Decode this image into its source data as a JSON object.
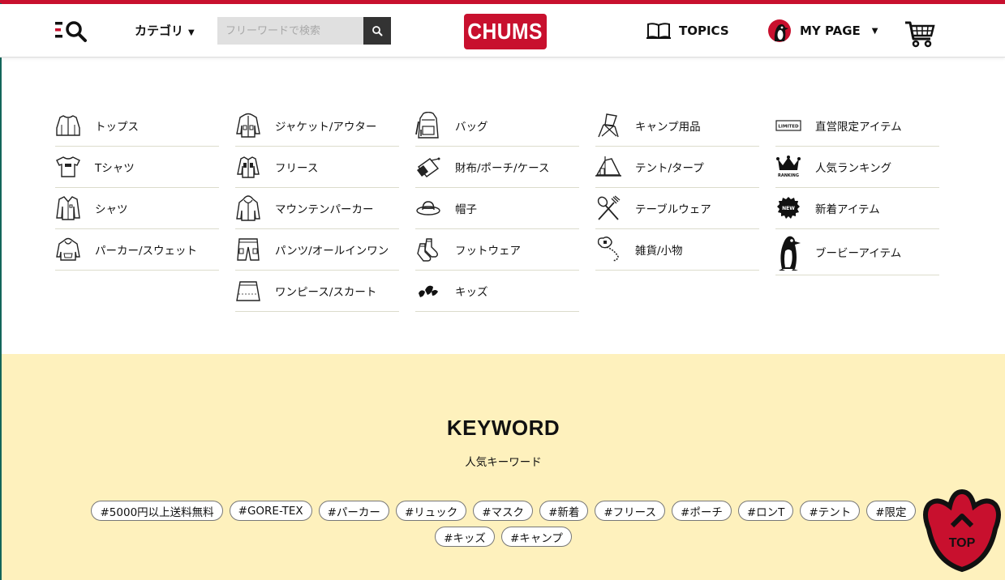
{
  "header": {
    "category_label": "カテゴリ",
    "search_placeholder": "フリーワードで検索",
    "logo_text": "CHUMS",
    "topics_label": "TOPICS",
    "mypage_label": "MY PAGE"
  },
  "categories": [
    [
      {
        "label": "トップス",
        "icon": "jacket-icon"
      },
      {
        "label": "Tシャツ",
        "icon": "tshirt-icon"
      },
      {
        "label": "シャツ",
        "icon": "shirt-icon"
      },
      {
        "label": "パーカー/スウェット",
        "icon": "hoodie-icon"
      }
    ],
    [
      {
        "label": "ジャケット/アウター",
        "icon": "outer-jacket-icon"
      },
      {
        "label": "フリース",
        "icon": "fleece-icon"
      },
      {
        "label": "マウンテンパーカー",
        "icon": "mountain-parka-icon"
      },
      {
        "label": "パンツ/オールインワン",
        "icon": "pants-icon"
      },
      {
        "label": "ワンピース/スカート",
        "icon": "skirt-icon"
      }
    ],
    [
      {
        "label": "バッグ",
        "icon": "backpack-icon"
      },
      {
        "label": "財布/ポーチ/ケース",
        "icon": "wallet-icon"
      },
      {
        "label": "帽子",
        "icon": "hat-icon"
      },
      {
        "label": "フットウェア",
        "icon": "socks-icon"
      },
      {
        "label": "キッズ",
        "icon": "kids-icon"
      }
    ],
    [
      {
        "label": "キャンプ用品",
        "icon": "camp-chair-icon"
      },
      {
        "label": "テント/タープ",
        "icon": "tent-icon"
      },
      {
        "label": "テーブルウェア",
        "icon": "cutlery-icon"
      },
      {
        "label": "雑貨/小物",
        "icon": "keychain-icon"
      }
    ],
    [
      {
        "label": "直営限定アイテム",
        "icon": "limited-icon",
        "badge": "LIMITED"
      },
      {
        "label": "人気ランキング",
        "icon": "crown-icon",
        "badge": "RANKING"
      },
      {
        "label": "新着アイテム",
        "icon": "new-icon",
        "badge": "NEW"
      },
      {
        "label": "ブービーアイテム",
        "icon": "booby-bird-icon"
      }
    ]
  ],
  "keyword": {
    "title": "KEYWORD",
    "subtitle": "人気キーワード",
    "tags": [
      "#5000円以上送料無料",
      "#GORE-TEX",
      "#パーカー",
      "#リュック",
      "#マスク",
      "#新着",
      "#フリース",
      "#ポーチ",
      "#ロンT",
      "#テント",
      "#限定",
      "#キッズ",
      "#キャンプ"
    ]
  },
  "top_button": {
    "label": "TOP"
  },
  "colors": {
    "brand": "#c8102e",
    "keyword_bg": "#fef1bd",
    "search_btn": "#333333"
  }
}
